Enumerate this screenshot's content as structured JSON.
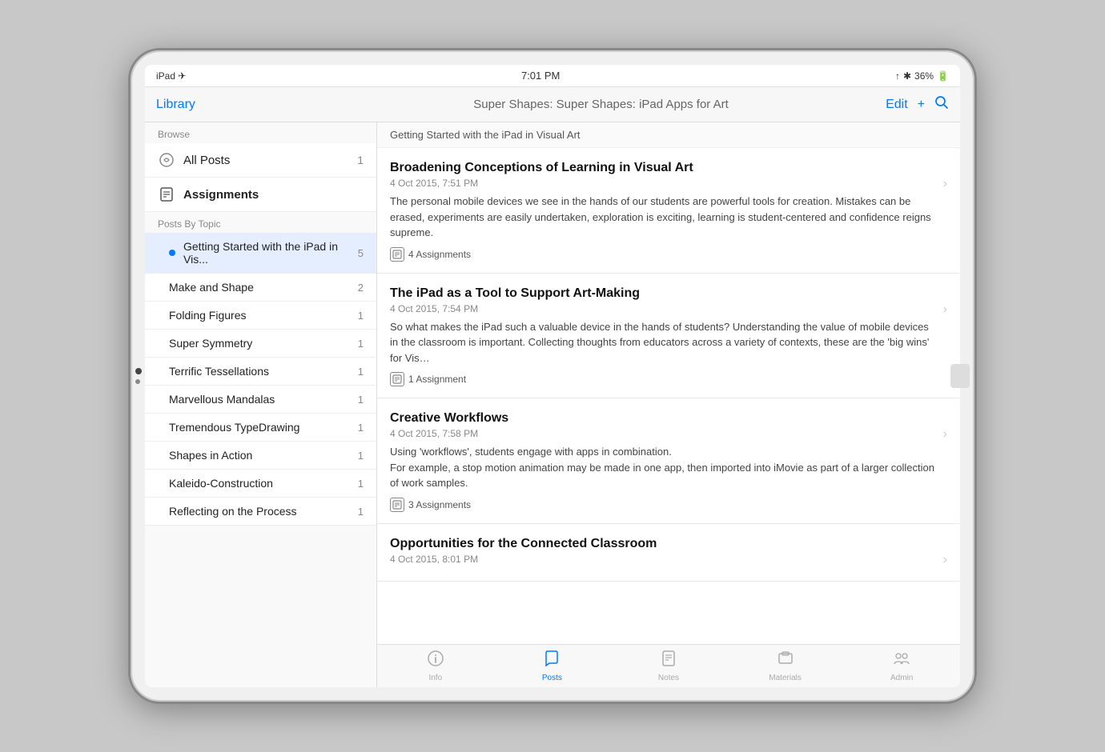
{
  "statusBar": {
    "left": "iPad ✈",
    "center": "7:01 PM",
    "right": "36%"
  },
  "navBar": {
    "library": "Library",
    "title": "Super Shapes: Super Shapes: iPad Apps for Art",
    "edit": "Edit",
    "add": "+",
    "search": "🔍"
  },
  "breadcrumb": "Getting Started with the iPad in Visual Art",
  "sidebar": {
    "browseLabel": "Browse",
    "allPostsLabel": "All Posts",
    "allPostsCount": "1",
    "assignmentsLabel": "Assignments",
    "postsByTopicLabel": "Posts By Topic",
    "topics": [
      {
        "label": "Getting Started with the iPad in Vis...",
        "count": "5",
        "active": true,
        "dot": true
      },
      {
        "label": "Make and Shape",
        "count": "2",
        "active": false,
        "dot": false
      },
      {
        "label": "Folding Figures",
        "count": "1",
        "active": false,
        "dot": false
      },
      {
        "label": "Super Symmetry",
        "count": "1",
        "active": false,
        "dot": false
      },
      {
        "label": "Terrific Tessellations",
        "count": "1",
        "active": false,
        "dot": false
      },
      {
        "label": "Marvellous Mandalas",
        "count": "1",
        "active": false,
        "dot": false
      },
      {
        "label": "Tremendous TypeDrawing",
        "count": "1",
        "active": false,
        "dot": false
      },
      {
        "label": "Shapes in Action",
        "count": "1",
        "active": false,
        "dot": false
      },
      {
        "label": "Kaleido-Construction",
        "count": "1",
        "active": false,
        "dot": false
      },
      {
        "label": "Reflecting on the Process",
        "count": "1",
        "active": false,
        "dot": false
      }
    ]
  },
  "posts": [
    {
      "title": "Broadening Conceptions of Learning in Visual Art",
      "date": "4 Oct 2015, 7:51 PM",
      "excerpt": "The personal mobile devices we see in the hands of our students are powerful tools for creation.  Mistakes can be erased, experiments are easily undertaken, exploration is exciting, learning is student-centered and confidence reigns supreme.",
      "badge": "4 Assignments"
    },
    {
      "title": "The iPad as a Tool to Support Art-Making",
      "date": "4 Oct 2015, 7:54 PM",
      "excerpt": "So what makes the iPad such a valuable device in the hands of students?  Understanding the value of mobile devices in the classroom is important.  Collecting thoughts from educators across a variety of contexts, these are the 'big wins' for Vis…",
      "badge": "1 Assignment"
    },
    {
      "title": "Creative Workflows",
      "date": "4 Oct 2015, 7:58 PM",
      "excerpt": "Using 'workflows', students engage with apps in combination.\nFor example, a stop motion animation may be made in one app, then imported into iMovie as part of a larger collection of work samples.",
      "badge": "3 Assignments"
    },
    {
      "title": "Opportunities for the Connected Classroom",
      "date": "4 Oct 2015, 8:01 PM",
      "excerpt": "",
      "badge": ""
    }
  ],
  "tabs": [
    {
      "icon": "ℹ",
      "label": "Info",
      "active": false
    },
    {
      "icon": "💬",
      "label": "Posts",
      "active": true
    },
    {
      "icon": "☰",
      "label": "Notes",
      "active": false
    },
    {
      "icon": "⬛",
      "label": "Materials",
      "active": false
    },
    {
      "icon": "👥",
      "label": "Admin",
      "active": false
    }
  ]
}
